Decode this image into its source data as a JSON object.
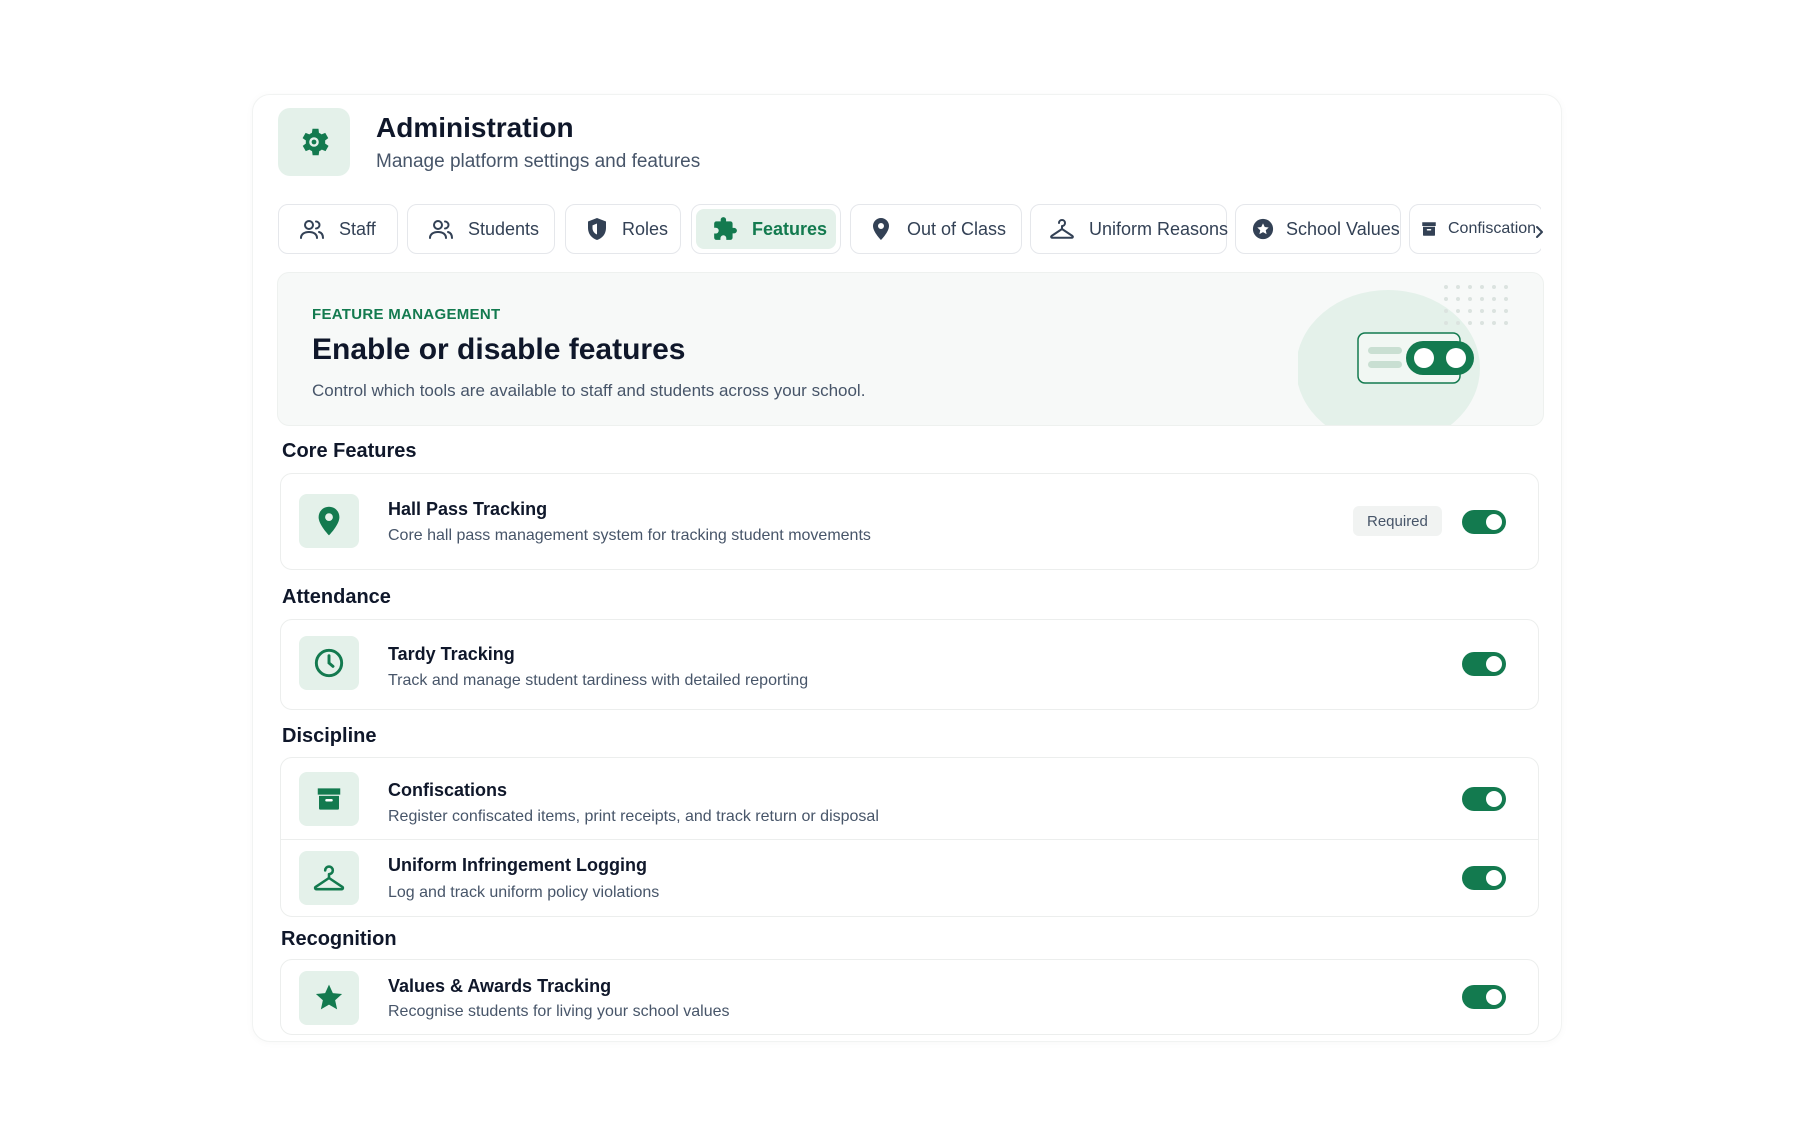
{
  "header": {
    "title": "Administration",
    "subtitle": "Manage platform settings and features",
    "icon": "gear-icon"
  },
  "tabs": [
    {
      "label": "Staff",
      "icon": "users-icon",
      "active": false
    },
    {
      "label": "Students",
      "icon": "users-icon",
      "active": false
    },
    {
      "label": "Roles",
      "icon": "shield-icon",
      "active": false
    },
    {
      "label": "Features",
      "icon": "puzzle-icon",
      "active": true
    },
    {
      "label": "Out of Class",
      "icon": "map-pin-icon",
      "active": false
    },
    {
      "label": "Uniform Reasons",
      "icon": "hanger-icon",
      "active": false
    },
    {
      "label": "School Values",
      "icon": "star-circle-icon",
      "active": false
    },
    {
      "label": "Confiscation",
      "icon": "archive-icon",
      "active": false
    }
  ],
  "hero": {
    "eyebrow": "FEATURE MANAGEMENT",
    "title": "Enable or disable features",
    "description": "Control which tools are available to staff and students across your school."
  },
  "sections": {
    "core": {
      "title": "Core Features",
      "items": [
        {
          "name": "Hall Pass Tracking",
          "description": "Core hall pass management system for tracking student movements",
          "badge": "Required",
          "enabled": true,
          "icon": "map-pin-icon"
        }
      ]
    },
    "attendance": {
      "title": "Attendance",
      "items": [
        {
          "name": "Tardy Tracking",
          "description": "Track and manage student tardiness with detailed reporting",
          "enabled": true,
          "icon": "clock-icon"
        }
      ]
    },
    "discipline": {
      "title": "Discipline",
      "items": [
        {
          "name": "Confiscations",
          "description": "Register confiscated items, print receipts, and track return or disposal",
          "enabled": true,
          "icon": "archive-icon"
        },
        {
          "name": "Uniform Infringement Logging",
          "description": "Log and track uniform policy violations",
          "enabled": true,
          "icon": "hanger-icon"
        }
      ]
    },
    "recognition": {
      "title": "Recognition",
      "items": [
        {
          "name": "Values & Awards Tracking",
          "description": "Recognise students for living your school values",
          "enabled": true,
          "icon": "star-icon"
        }
      ]
    }
  },
  "colors": {
    "accent": "#137a4f",
    "accent_soft": "#e4f1ea",
    "text_primary": "#0f172a",
    "text_secondary": "#475569"
  }
}
